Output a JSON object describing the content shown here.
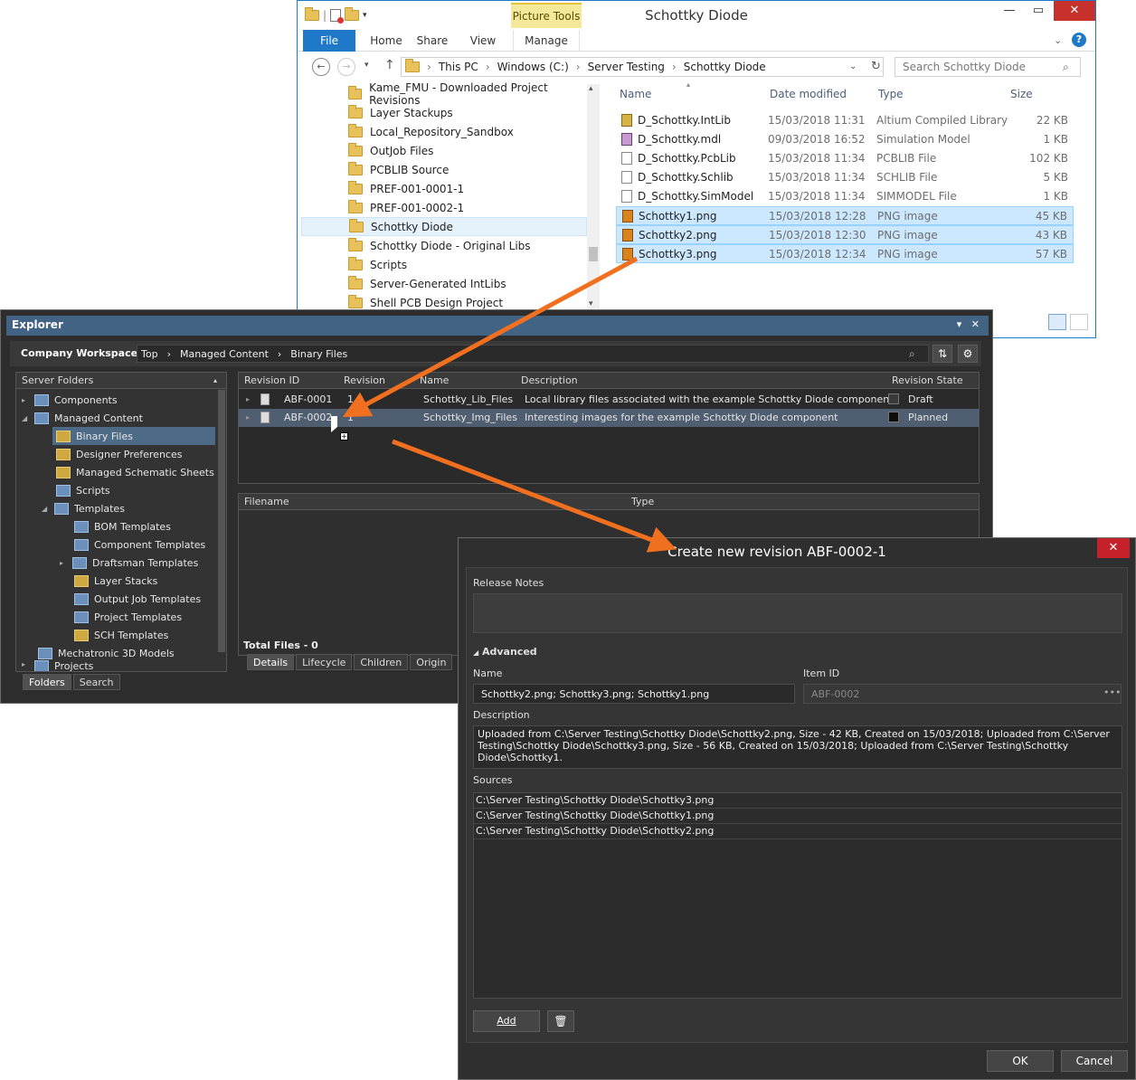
{
  "file_explorer": {
    "title": "Schottky Diode",
    "context_tab": "Picture Tools",
    "ribbon_tabs": [
      "File",
      "Home",
      "Share",
      "View",
      "Manage"
    ],
    "breadcrumb": [
      "This PC",
      "Windows (C:)",
      "Server Testing",
      "Schottky Diode"
    ],
    "search_placeholder": "Search Schottky Diode",
    "folders": [
      "Kame_FMU - Downloaded Project Revisions",
      "Layer Stackups",
      "Local_Repository_Sandbox",
      "OutJob Files",
      "PCBLIB Source",
      "PREF-001-0001-1",
      "PREF-001-0002-1",
      "Schottky Diode",
      "Schottky Diode - Original Libs",
      "Scripts",
      "Server-Generated IntLibs",
      "Shell PCB Design Project"
    ],
    "columns": [
      "Name",
      "Date modified",
      "Type",
      "Size"
    ],
    "files": [
      {
        "name": "D_Schottky.IntLib",
        "date": "15/03/2018 11:31",
        "type": "Altium Compiled Library",
        "size": "22 KB"
      },
      {
        "name": "D_Schottky.mdl",
        "date": "09/03/2018 16:52",
        "type": "Simulation Model",
        "size": "1 KB"
      },
      {
        "name": "D_Schottky.PcbLib",
        "date": "15/03/2018 11:34",
        "type": "PCBLIB File",
        "size": "102 KB"
      },
      {
        "name": "D_Schottky.Schlib",
        "date": "15/03/2018 11:34",
        "type": "SCHLIB File",
        "size": "5 KB"
      },
      {
        "name": "D_Schottky.SimModel",
        "date": "15/03/2018 11:34",
        "type": "SIMMODEL File",
        "size": "1 KB"
      },
      {
        "name": "Schottky1.png",
        "date": "15/03/2018 12:28",
        "type": "PNG image",
        "size": "45 KB"
      },
      {
        "name": "Schottky2.png",
        "date": "15/03/2018 12:30",
        "type": "PNG image",
        "size": "43 KB"
      },
      {
        "name": "Schottky3.png",
        "date": "15/03/2018 12:34",
        "type": "PNG image",
        "size": "57 KB"
      }
    ]
  },
  "explorer_panel": {
    "title": "Explorer",
    "workspace": "Company Workspace",
    "breadcrumb": [
      "Top",
      "Managed Content",
      "Binary Files"
    ],
    "server_folders_label": "Server Folders",
    "tree": [
      {
        "label": "Components",
        "indent": 0,
        "expander": "▸"
      },
      {
        "label": "Managed Content",
        "indent": 0,
        "expander": "◢"
      },
      {
        "label": "Binary Files",
        "indent": 1,
        "expander": ""
      },
      {
        "label": "Designer Preferences",
        "indent": 1,
        "expander": ""
      },
      {
        "label": "Managed Schematic Sheets",
        "indent": 1,
        "expander": ""
      },
      {
        "label": "Scripts",
        "indent": 1,
        "expander": ""
      },
      {
        "label": "Templates",
        "indent": 1,
        "expander": "◢"
      },
      {
        "label": "BOM Templates",
        "indent": 2,
        "expander": ""
      },
      {
        "label": "Component Templates",
        "indent": 2,
        "expander": ""
      },
      {
        "label": "Draftsman Templates",
        "indent": 2,
        "expander": "▸"
      },
      {
        "label": "Layer Stacks",
        "indent": 2,
        "expander": ""
      },
      {
        "label": "Output Job Templates",
        "indent": 2,
        "expander": ""
      },
      {
        "label": "Project Templates",
        "indent": 2,
        "expander": ""
      },
      {
        "label": "SCH Templates",
        "indent": 2,
        "expander": ""
      },
      {
        "label": "Mechatronic 3D Models",
        "indent": 0,
        "expander": ""
      },
      {
        "label": "Projects",
        "indent": 0,
        "expander": "▸"
      }
    ],
    "left_tabs": [
      "Folders",
      "Search"
    ],
    "grid_columns": [
      "Revision ID",
      "Revision",
      "Name",
      "Description",
      "Revision State"
    ],
    "rows": [
      {
        "id": "ABF-0001",
        "revision": "1",
        "name": "Schottky_Lib_Files",
        "description": "Local library files associated with the example Schottky Diode component",
        "state": "Draft",
        "swatch": "#3a3a3a"
      },
      {
        "id": "ABF-0002",
        "revision": "1",
        "name": "Schottky_Img_Files",
        "description": "Interesting images for the example Schottky Diode component",
        "state": "Planned",
        "swatch": "#0d0d0d"
      }
    ],
    "file_columns": [
      "Filename",
      "Type"
    ],
    "total_files": "Total Files - 0",
    "bottom_tabs": [
      "Details",
      "Lifecycle",
      "Children",
      "Origin"
    ]
  },
  "dialog": {
    "title": "Create new revision ABF-0002-1",
    "release_notes_label": "Release Notes",
    "advanced_label": "Advanced",
    "name_label": "Name",
    "name_value": "Schottky2.png; Schottky3.png; Schottky1.png",
    "item_id_label": "Item ID",
    "item_id_value": "ABF-0002",
    "item_id_more": "•••",
    "description_label": "Description",
    "description_value": "Uploaded from C:\\Server Testing\\Schottky Diode\\Schottky2.png, Size - 42 KB, Created on 15/03/2018; Uploaded from C:\\Server Testing\\Schottky Diode\\Schottky3.png, Size - 56 KB, Created on 15/03/2018; Uploaded from C:\\Server Testing\\Schottky Diode\\Schottky1.",
    "sources_label": "Sources",
    "sources": [
      "C:\\Server Testing\\Schottky Diode\\Schottky3.png",
      "C:\\Server Testing\\Schottky Diode\\Schottky1.png",
      "C:\\Server Testing\\Schottky Diode\\Schottky2.png"
    ],
    "add_label": "Add",
    "ok_label": "OK",
    "cancel_label": "Cancel"
  },
  "colors": {
    "accent_arrow": "#f07020",
    "win_accent": "#1f79c8",
    "panel_header": "#426384",
    "dialog_close": "#c4212a"
  }
}
